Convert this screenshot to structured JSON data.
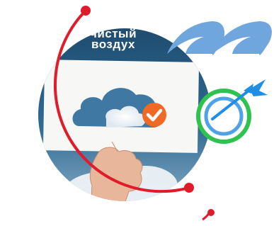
{
  "headline": {
    "line1": "чистый",
    "line2": "воздух"
  },
  "colors": {
    "accent_red": "#e01b2a",
    "photo_sky": "#2c5f86",
    "photo_sky_light": "#8fb2cc",
    "brand_blue": "#6fa6de",
    "target_green": "#2ec24f",
    "arrow_blue": "#1f8ee6",
    "check_orange": "#f06a25"
  },
  "icons": [
    "cloud-check-icon",
    "target-arrow-icon",
    "quote-mark-shape"
  ]
}
